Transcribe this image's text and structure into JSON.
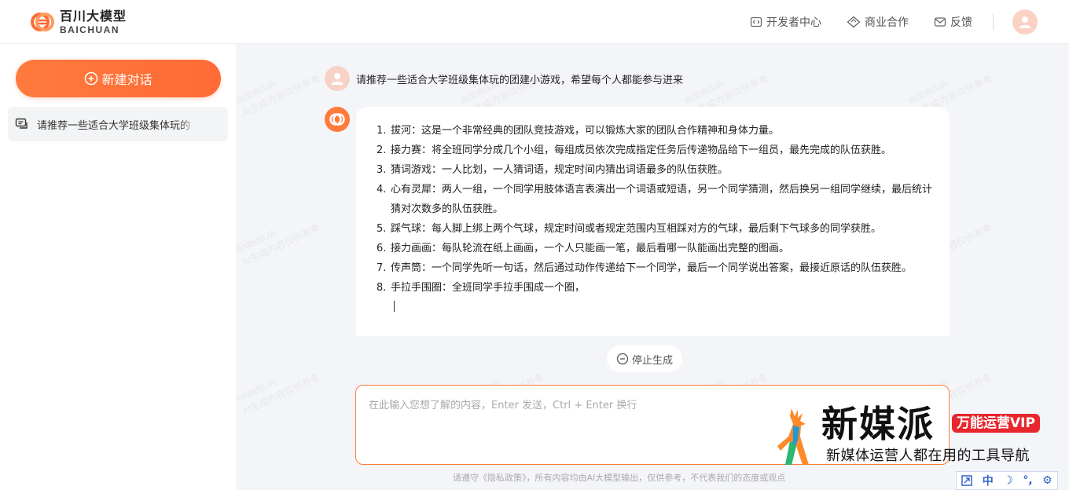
{
  "header": {
    "logo_cn": "百川大模型",
    "logo_en": "BAICHUAN",
    "nav": [
      {
        "label": "开发者中心",
        "icon": "code-icon"
      },
      {
        "label": "商业合作",
        "icon": "diamond-icon"
      },
      {
        "label": "反馈",
        "icon": "mail-icon"
      }
    ],
    "brand_color": "#ff6b35"
  },
  "sidebar": {
    "new_chat_label": "新建对话",
    "history": [
      {
        "label": "请推荐一些适合大学班级集体玩的"
      }
    ]
  },
  "chat": {
    "watermark_line1": "Wdbtl6UA",
    "watermark_line2": "AI生成内容仅供参考",
    "user_message": "请推荐一些适合大学班级集体玩的团建小游戏，希望每个人都能参与进来",
    "answer_items": [
      {
        "num": "1.",
        "text": "拔河：这是一个非常经典的团队竞技游戏，可以锻炼大家的团队合作精神和身体力量。"
      },
      {
        "num": "2.",
        "text": "接力赛：将全班同学分成几个小组，每组成员依次完成指定任务后传递物品给下一组员，最先完成的队伍获胜。"
      },
      {
        "num": "3.",
        "text": "猜词游戏：一人比划，一人猜词语，规定时间内猜出词语最多的队伍获胜。"
      },
      {
        "num": "4.",
        "text": "心有灵犀：两人一组，一个同学用肢体语言表演出一个词语或短语，另一个同学猜测，然后换另一组同学继续，最后统计猜对次数多的队伍获胜。"
      },
      {
        "num": "5.",
        "text": "踩气球：每人脚上绑上两个气球，规定时间或者规定范围内互相踩对方的气球，最后剩下气球多的同学获胜。"
      },
      {
        "num": "6.",
        "text": "接力画画：每队轮流在纸上画画，一个人只能画一笔，最后看哪一队能画出完整的图画。"
      },
      {
        "num": "7.",
        "text": "传声筒：一个同学先听一句话，然后通过动作传递给下一个同学，最后一个同学说出答案，最接近原话的队伍获胜。"
      },
      {
        "num": "8.",
        "text": "手拉手围圈：全班同学手拉手围成一个圈，"
      }
    ],
    "stop_label": "停止生成",
    "input_placeholder": "在此输入您想了解的内容，Enter 发送，Ctrl + Enter 换行",
    "input_value": "",
    "footer_note": "请遵守《隐私政策》，所有内容均由AI大模型输出，仅供参考，不代表我们的态度或观点"
  },
  "overlay": {
    "brand_title": "新媒派",
    "brand_badge": "万能运营VIP",
    "brand_sub": "新媒体运营人都在用的工具导航",
    "ime": [
      "中",
      "☽",
      "°,",
      "⚙"
    ]
  }
}
